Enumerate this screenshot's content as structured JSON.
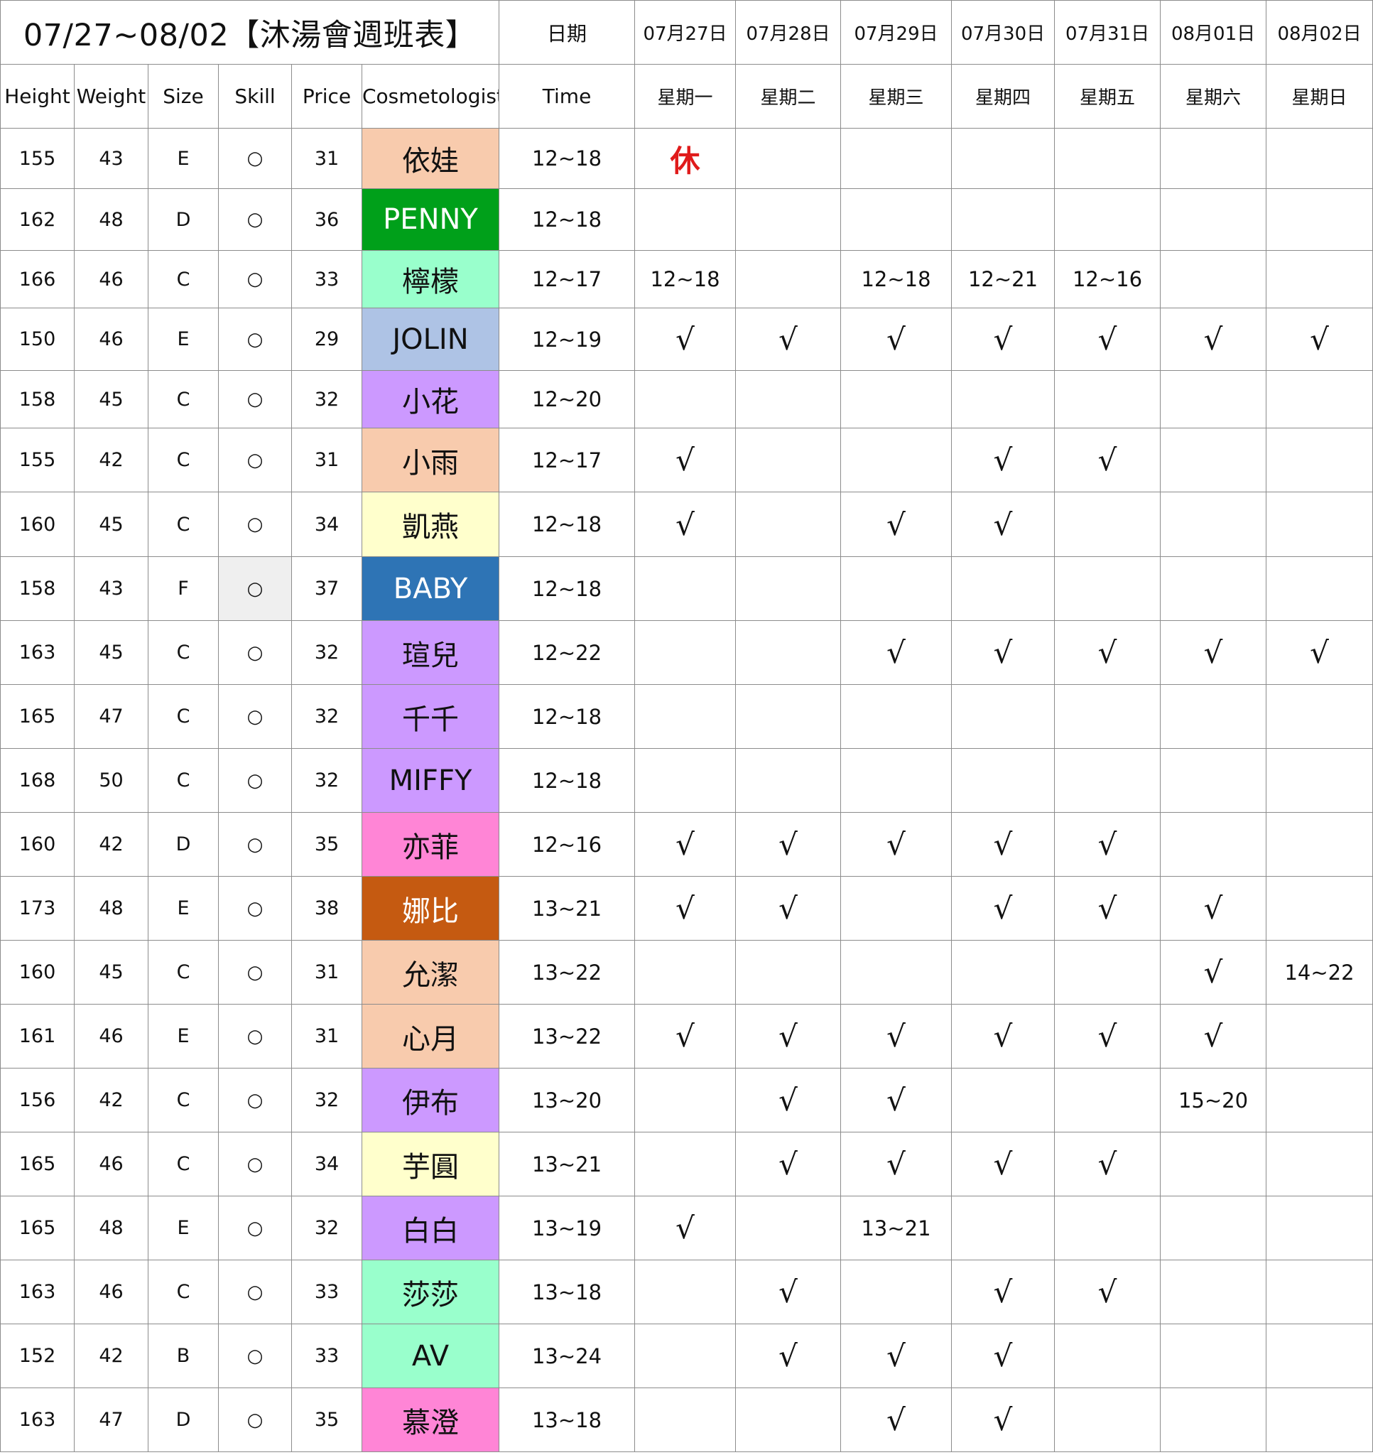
{
  "title": "07/27~08/02【沐湯會週班表】",
  "date_label": "日期",
  "time_label": "Time",
  "dates": [
    "07月27日",
    "07月28日",
    "07月29日",
    "07月30日",
    "07月31日",
    "08月01日",
    "08月02日"
  ],
  "weekdays": [
    "星期一",
    "星期二",
    "星期三",
    "星期四",
    "星期五",
    "星期六",
    "星期日"
  ],
  "headers": [
    "Height",
    "Weight",
    "Size",
    "Skill",
    "Price",
    "Cosmetologist"
  ],
  "colors": {
    "grid_line": "#8c8c8c",
    "rest_text": "#e01b1b",
    "shaded_cell": "#efefef"
  },
  "rows": [
    {
      "height": "155",
      "weight": "43",
      "size": "E",
      "skill": "○",
      "price": "31",
      "name": "依娃",
      "bg": "#f8cbad",
      "fg": "#111111",
      "time": "12~18",
      "days": [
        "休",
        "",
        "",
        "",
        "",
        "",
        ""
      ]
    },
    {
      "height": "162",
      "weight": "48",
      "size": "D",
      "skill": "○",
      "price": "36",
      "name": "PENNY",
      "bg": "#00a01a",
      "fg": "#ffffff",
      "time": "12~18",
      "days": [
        "",
        "",
        "",
        "",
        "",
        "",
        ""
      ]
    },
    {
      "height": "166",
      "weight": "46",
      "size": "C",
      "skill": "○",
      "price": "33",
      "name": "檸檬",
      "bg": "#99ffcc",
      "fg": "#111111",
      "time": "12~17",
      "days": [
        "12~18",
        "",
        "12~18",
        "12~21",
        "12~16",
        "",
        ""
      ]
    },
    {
      "height": "150",
      "weight": "46",
      "size": "E",
      "skill": "○",
      "price": "29",
      "name": "JOLIN",
      "bg": "#aec3e5",
      "fg": "#111111",
      "time": "12~19",
      "days": [
        "√",
        "√",
        "√",
        "√",
        "√",
        "√",
        "√"
      ]
    },
    {
      "height": "158",
      "weight": "45",
      "size": "C",
      "skill": "○",
      "price": "32",
      "name": "小花",
      "bg": "#cc99ff",
      "fg": "#111111",
      "time": "12~20",
      "days": [
        "",
        "",
        "",
        "",
        "",
        "",
        ""
      ]
    },
    {
      "height": "155",
      "weight": "42",
      "size": "C",
      "skill": "○",
      "price": "31",
      "name": "小雨",
      "bg": "#f8cbad",
      "fg": "#111111",
      "time": "12~17",
      "days": [
        "√",
        "",
        "",
        "√",
        "√",
        "",
        ""
      ]
    },
    {
      "height": "160",
      "weight": "45",
      "size": "C",
      "skill": "○",
      "price": "34",
      "name": "凱燕",
      "bg": "#ffffcc",
      "fg": "#111111",
      "time": "12~18",
      "days": [
        "√",
        "",
        "√",
        "√",
        "",
        "",
        ""
      ]
    },
    {
      "height": "158",
      "weight": "43",
      "size": "F",
      "skill": "○",
      "price": "37",
      "name": "BABY",
      "bg": "#2e74b5",
      "fg": "#ffffff",
      "time": "12~18",
      "days": [
        "",
        "",
        "",
        "",
        "",
        "",
        ""
      ],
      "shaded_skill": true
    },
    {
      "height": "163",
      "weight": "45",
      "size": "C",
      "skill": "○",
      "price": "32",
      "name": "瑄兒",
      "bg": "#cc99ff",
      "fg": "#111111",
      "time": "12~22",
      "days": [
        "",
        "",
        "√",
        "√",
        "√",
        "√",
        "√"
      ]
    },
    {
      "height": "165",
      "weight": "47",
      "size": "C",
      "skill": "○",
      "price": "32",
      "name": "千千",
      "bg": "#cc99ff",
      "fg": "#111111",
      "time": "12~18",
      "days": [
        "",
        "",
        "",
        "",
        "",
        "",
        ""
      ]
    },
    {
      "height": "168",
      "weight": "50",
      "size": "C",
      "skill": "○",
      "price": "32",
      "name": "MIFFY",
      "bg": "#cc99ff",
      "fg": "#111111",
      "time": "12~18",
      "days": [
        "",
        "",
        "",
        "",
        "",
        "",
        ""
      ]
    },
    {
      "height": "160",
      "weight": "42",
      "size": "D",
      "skill": "○",
      "price": "35",
      "name": "亦菲",
      "bg": "#ff85d6",
      "fg": "#111111",
      "time": "12~16",
      "days": [
        "√",
        "√",
        "√",
        "√",
        "√",
        "",
        ""
      ]
    },
    {
      "height": "173",
      "weight": "48",
      "size": "E",
      "skill": "○",
      "price": "38",
      "name": "娜比",
      "bg": "#c55a11",
      "fg": "#ffffff",
      "time": "13~21",
      "days": [
        "√",
        "√",
        "",
        "√",
        "√",
        "√",
        ""
      ]
    },
    {
      "height": "160",
      "weight": "45",
      "size": "C",
      "skill": "○",
      "price": "31",
      "name": "允潔",
      "bg": "#f8cbad",
      "fg": "#111111",
      "time": "13~22",
      "days": [
        "",
        "",
        "",
        "",
        "",
        "√",
        "14~22"
      ]
    },
    {
      "height": "161",
      "weight": "46",
      "size": "E",
      "skill": "○",
      "price": "31",
      "name": "心月",
      "bg": "#f8cbad",
      "fg": "#111111",
      "time": "13~22",
      "days": [
        "√",
        "√",
        "√",
        "√",
        "√",
        "√",
        ""
      ]
    },
    {
      "height": "156",
      "weight": "42",
      "size": "C",
      "skill": "○",
      "price": "32",
      "name": "伊布",
      "bg": "#cc99ff",
      "fg": "#111111",
      "time": "13~20",
      "days": [
        "",
        "√",
        "√",
        "",
        "",
        "15~20",
        ""
      ]
    },
    {
      "height": "165",
      "weight": "46",
      "size": "C",
      "skill": "○",
      "price": "34",
      "name": "芋圓",
      "bg": "#ffffcc",
      "fg": "#111111",
      "time": "13~21",
      "days": [
        "",
        "√",
        "√",
        "√",
        "√",
        "",
        ""
      ]
    },
    {
      "height": "165",
      "weight": "48",
      "size": "E",
      "skill": "○",
      "price": "32",
      "name": "白白",
      "bg": "#cc99ff",
      "fg": "#111111",
      "time": "13~19",
      "days": [
        "√",
        "",
        "13~21",
        "",
        "",
        "",
        ""
      ]
    },
    {
      "height": "163",
      "weight": "46",
      "size": "C",
      "skill": "○",
      "price": "33",
      "name": "莎莎",
      "bg": "#99ffcc",
      "fg": "#111111",
      "time": "13~18",
      "days": [
        "",
        "√",
        "",
        "√",
        "√",
        "",
        ""
      ]
    },
    {
      "height": "152",
      "weight": "42",
      "size": "B",
      "skill": "○",
      "price": "33",
      "name": "AV",
      "bg": "#99ffcc",
      "fg": "#111111",
      "time": "13~24",
      "days": [
        "",
        "√",
        "√",
        "√",
        "",
        "",
        ""
      ]
    },
    {
      "height": "163",
      "weight": "47",
      "size": "D",
      "skill": "○",
      "price": "35",
      "name": "慕澄",
      "bg": "#ff85d6",
      "fg": "#111111",
      "time": "13~18",
      "days": [
        "",
        "",
        "√",
        "√",
        "",
        "",
        ""
      ]
    }
  ]
}
